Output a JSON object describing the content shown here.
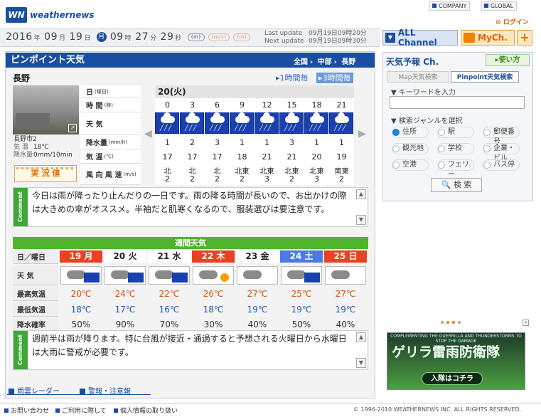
{
  "header": {
    "logo_text": "weathernews",
    "logo_mark": "WN",
    "company_link": "COMPANY",
    "global_link": "GLOBAL",
    "login_link": "ログイン",
    "date": {
      "year": "2016",
      "y": "年",
      "month": "09",
      "m": "月",
      "day": "19",
      "d": "日",
      "weekday": "月",
      "hour": "09",
      "h": "時",
      "min": "27",
      "mi": "分",
      "sec": "29",
      "s": "秒"
    },
    "unit_pills": [
      "(m)",
      "(m/s)",
      "(m)"
    ],
    "last_update_label": "Last update",
    "last_update_value": "09月19日09時20分",
    "next_update_label": "Next update",
    "next_update_value": "09月19日09時30分",
    "all_channel": "ALL Channel",
    "mych": "MyCh.",
    "plus": "+"
  },
  "pinpoint": {
    "title": "ピンポイント天気",
    "breadcrumb": [
      "全国",
      "中部",
      "長野"
    ],
    "location": "長野",
    "tab_1h": "1時間毎",
    "tab_3h": "3時間毎",
    "station_name": "長野市2",
    "station_temp_label": "気 温",
    "station_temp": "18℃",
    "station_rain_label": "降水量",
    "station_rain": "0mm/10min",
    "jikkyo": "実 況 値",
    "row_labels": [
      {
        "label": "日",
        "unit": "(曜日)"
      },
      {
        "label": "時 間",
        "unit": "(時)"
      },
      {
        "label": "天 気",
        "unit": ""
      },
      {
        "label": "降水量",
        "unit": "(mm/h)"
      },
      {
        "label": "気 温",
        "unit": "(℃)"
      },
      {
        "label": "風 向 風 速",
        "unit": "(m/s)"
      }
    ],
    "day": "20(火)",
    "hours": [
      "0",
      "3",
      "6",
      "9",
      "12",
      "15",
      "18",
      "21"
    ],
    "weather": [
      "rain-icon",
      "rain-icon",
      "rain-icon",
      "rain-icon",
      "rain-icon",
      "rain-icon",
      "rain-icon",
      "rain-icon"
    ],
    "rain": [
      "1",
      "2",
      "3",
      "1",
      "1",
      "3",
      "1",
      "1"
    ],
    "temp": [
      "17",
      "17",
      "17",
      "18",
      "21",
      "21",
      "20",
      "19"
    ],
    "wind_dir": [
      "北",
      "北",
      "北",
      "北東",
      "北東",
      "北東",
      "北東",
      "南東"
    ],
    "wind_speed": [
      "2",
      "2",
      "2",
      "2",
      "3",
      "2",
      "3",
      "2"
    ],
    "comment_tag": "Comment",
    "comment": "今日は雨が降ったり止んだりの一日です。雨の降る時間が長いので、お出かけの際は大きめの傘がオススメ。半袖だと肌寒くなるので、服装選びは要注意です。"
  },
  "weekly": {
    "title": "週間天気",
    "row_labels": [
      "日／曜日",
      "天 気",
      "最高気温",
      "最低気温",
      "降水確率"
    ],
    "days": [
      {
        "d": "19",
        "w": "月",
        "color": "#e8421e",
        "icon": "cloud-rain-icon",
        "hi": "20℃",
        "lo": "18℃",
        "pop": "50%"
      },
      {
        "d": "20",
        "w": "火",
        "color": "#ffffff",
        "icon": "cloud-rain-icon",
        "hi": "24℃",
        "lo": "17℃",
        "pop": "90%"
      },
      {
        "d": "21",
        "w": "水",
        "color": "#ffffff",
        "icon": "rain-cloud-icon",
        "hi": "22℃",
        "lo": "16℃",
        "pop": "70%"
      },
      {
        "d": "22",
        "w": "木",
        "color": "#e8421e",
        "icon": "cloud-sun-icon",
        "hi": "26℃",
        "lo": "18℃",
        "pop": "30%"
      },
      {
        "d": "23",
        "w": "金",
        "color": "#ffffff",
        "icon": "cloud-icon",
        "hi": "27℃",
        "lo": "19℃",
        "pop": "40%"
      },
      {
        "d": "24",
        "w": "土",
        "color": "#4a7be0",
        "icon": "cloud-rain-icon",
        "hi": "25℃",
        "lo": "19℃",
        "pop": "50%"
      },
      {
        "d": "25",
        "w": "日",
        "color": "#e8421e",
        "icon": "cloud-icon",
        "hi": "27℃",
        "lo": "19℃",
        "pop": "40%"
      }
    ],
    "comment_tag": "Comment",
    "comment": "週前半は雨が降ります。特に台風が接近・通過すると予想される火曜日から水曜日は大雨に警戒が必要です。"
  },
  "bottom_links": [
    "雨雲レーダー",
    "警報・注意報"
  ],
  "sidebar": {
    "title": "天気予報 Ch.",
    "help": "使い方",
    "tab_map": "Map天気検索",
    "tab_pinpoint": "Pinpoint天気検索",
    "keyword_label": "▼ キーワードを入力",
    "genre_label": "▼ 検索ジャンルを選択",
    "genres": [
      "住所",
      "駅",
      "郵便番号",
      "観光地",
      "学校",
      "企業・ビル",
      "空港",
      "フェリー",
      "バス停"
    ],
    "search_button": "検 索",
    "banner_small": "COMPLEMENTING THE GUERRILLA AND THUNDERSTORMS TO STOP THE DAMAGE",
    "banner_title": "ゲリラ雷雨防衛隊",
    "banner_button": "入隊はコチラ"
  },
  "footer": {
    "links": [
      "お問い合わせ",
      "ご利用に際して",
      "個人情報の取り扱い"
    ],
    "copyright": "© 1996-2010 WEATHERNEWS INC. ALL RIGHTS RESERVED."
  }
}
